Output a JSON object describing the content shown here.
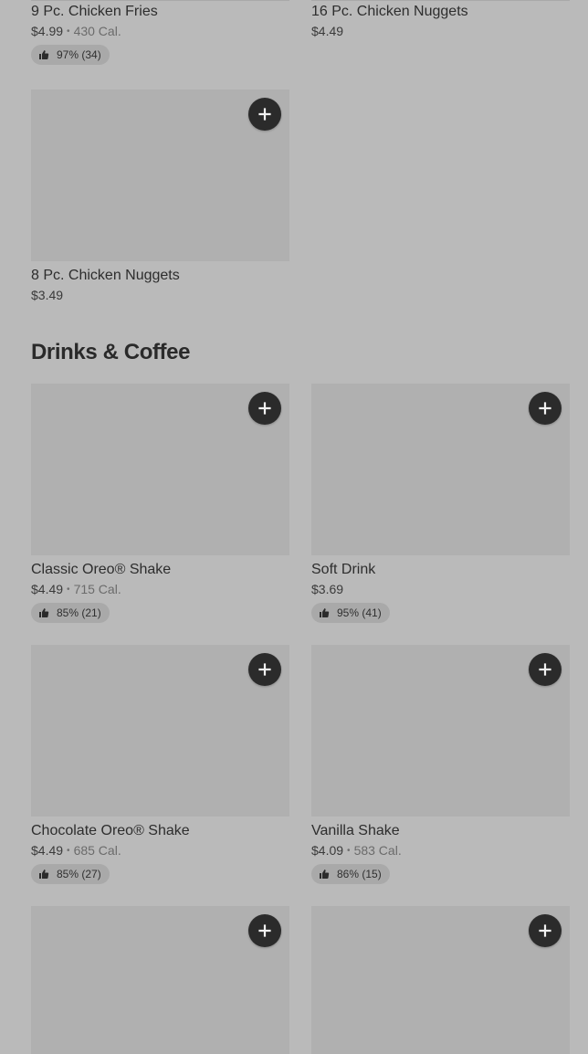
{
  "section": {
    "title": "Drinks & Coffee"
  },
  "items": {
    "chicken_fries": {
      "name": "9 Pc. Chicken Fries",
      "price": "$4.99",
      "calories": "430 Cal.",
      "rating": "97% (34)"
    },
    "nuggets_16": {
      "name": "16 Pc. Chicken Nuggets",
      "price": "$4.49"
    },
    "nuggets_8": {
      "name": "8 Pc. Chicken Nuggets",
      "price": "$3.49"
    },
    "classic_oreo_shake": {
      "name": "Classic Oreo® Shake",
      "price": "$4.49",
      "calories": "715 Cal.",
      "rating": "85% (21)"
    },
    "soft_drink": {
      "name": "Soft Drink",
      "price": "$3.69",
      "rating": "95% (41)"
    },
    "chocolate_oreo_shake": {
      "name": "Chocolate Oreo® Shake",
      "price": "$4.49",
      "calories": "685 Cal.",
      "rating": "85% (27)"
    },
    "vanilla_shake": {
      "name": "Vanilla Shake",
      "price": "$4.09",
      "calories": "583 Cal.",
      "rating": "86% (15)"
    }
  },
  "separator": "•",
  "icons": {
    "add": "plus-icon",
    "rating": "thumbs-up-icon"
  },
  "colors": {
    "page_background": "#bababa",
    "image_placeholder": "#b0b0b0",
    "add_button": "#2b2b2b",
    "rating_pill": "#a9a9a9"
  }
}
